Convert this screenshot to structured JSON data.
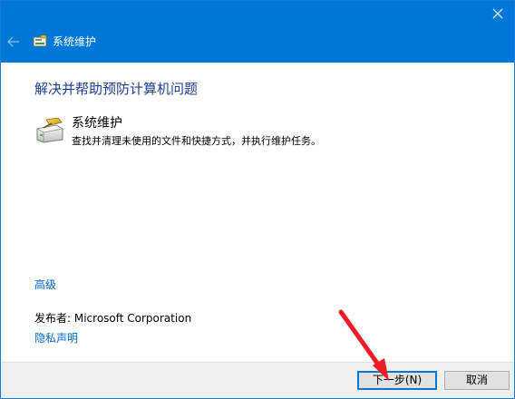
{
  "window": {
    "title": "系统维护",
    "title_icon": "maintenance-icon",
    "accent_color": "#0078d7",
    "close_icon": "close-icon",
    "back_icon": "back-arrow-icon"
  },
  "main": {
    "heading": "解决并帮助预防计算机问题",
    "item": {
      "icon": "maintenance-icon",
      "title": "系统维护",
      "description": "查找并清理未使用的文件和快捷方式，并执行维护任务。"
    },
    "advanced_link": "高级",
    "publisher": "发布者:  Microsoft Corporation",
    "privacy_link": "隐私声明"
  },
  "footer": {
    "next_label": "下一步(N)",
    "cancel_label": "取消"
  },
  "annotation": {
    "arrow_color": "#ee1c24",
    "arrow_icon": "red-arrow-annotation"
  }
}
